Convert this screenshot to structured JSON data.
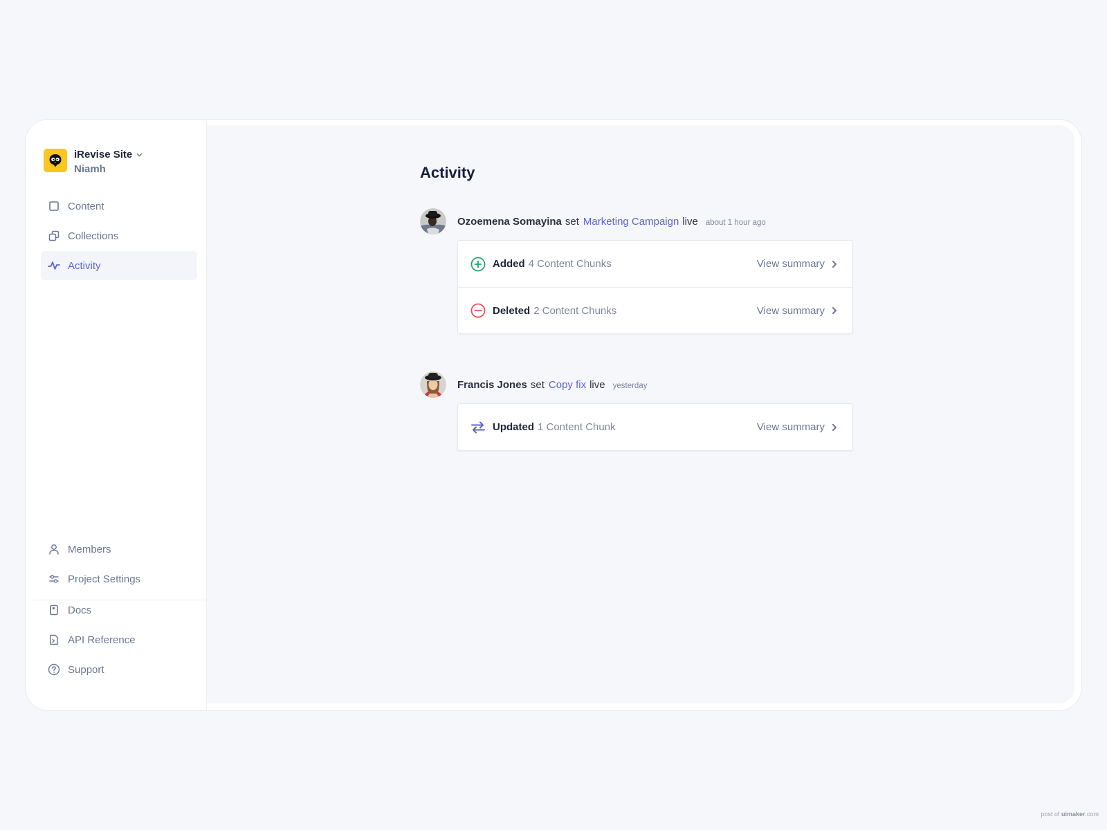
{
  "workspace": {
    "name": "iRevise Site",
    "user": "Niamh",
    "logo_color": "#fbc620"
  },
  "sidebar": {
    "primary": [
      {
        "label": "Content",
        "icon": "square-icon",
        "active": false
      },
      {
        "label": "Collections",
        "icon": "collections-icon",
        "active": false
      },
      {
        "label": "Activity",
        "icon": "activity-icon",
        "active": true
      }
    ],
    "secondary": [
      {
        "label": "Members",
        "icon": "user-icon"
      },
      {
        "label": "Project Settings",
        "icon": "sliders-icon"
      }
    ],
    "footer": [
      {
        "label": "Docs",
        "icon": "book-icon"
      },
      {
        "label": "API Reference",
        "icon": "code-file-icon"
      },
      {
        "label": "Support",
        "icon": "help-circle-icon"
      }
    ]
  },
  "page": {
    "title": "Activity"
  },
  "events": [
    {
      "user": "Ozoemena Somayina",
      "verb": "set",
      "target": "Marketing Campaign",
      "suffix": "live",
      "time": "about 1 hour ago",
      "changes": [
        {
          "action": "Added",
          "count": "4 Content Chunks",
          "icon": "plus-circle-icon",
          "color": "#1ea672",
          "link": "View summary"
        },
        {
          "action": "Deleted",
          "count": "2 Content Chunks",
          "icon": "minus-circle-icon",
          "color": "#ef4f4f",
          "link": "View summary"
        }
      ]
    },
    {
      "user": "Francis Jones",
      "verb": "set",
      "target": "Copy fix",
      "suffix": "live",
      "time": "yesterday",
      "changes": [
        {
          "action": "Updated",
          "count": "1 Content Chunk",
          "icon": "swap-arrows-icon",
          "color": "#5b63d3",
          "link": "View summary"
        }
      ]
    }
  ],
  "colors": {
    "accent": "#5b63d3",
    "added": "#1ea672",
    "deleted": "#ef4f4f",
    "muted": "#6b7794",
    "background": "#f6f7fb"
  },
  "watermark": {
    "prefix": "post of",
    "brand": "uimaker",
    "suffix": ".com"
  }
}
